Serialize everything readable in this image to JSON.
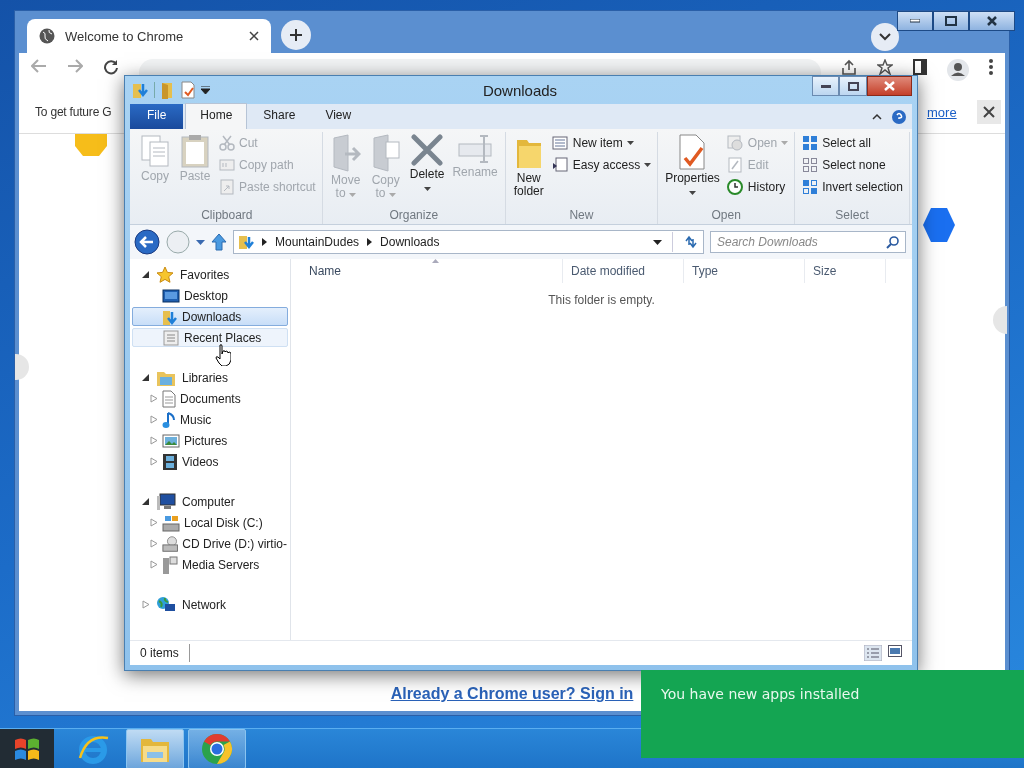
{
  "browser": {
    "tab": {
      "title": "Welcome to Chrome",
      "selected": true
    },
    "infobar": {
      "text": "To get future G",
      "link": "more"
    },
    "signin_link": "Already a Chrome user? Sign in"
  },
  "explorer": {
    "title": "Downloads",
    "ribbon_tabs": [
      {
        "label": "File",
        "kind": "file",
        "selected": false
      },
      {
        "label": "Home",
        "kind": "tab",
        "selected": true
      },
      {
        "label": "Share",
        "kind": "tab",
        "selected": false
      },
      {
        "label": "View",
        "kind": "tab",
        "selected": false
      }
    ],
    "ribbon_groups": [
      {
        "label": "Clipboard",
        "commands": [
          {
            "label": "Copy",
            "kind": "large",
            "disabled": true,
            "menu": false
          },
          {
            "label": "Paste",
            "kind": "large",
            "disabled": true,
            "menu": false
          },
          {
            "label": "Cut",
            "kind": "small",
            "disabled": true,
            "menu": false
          },
          {
            "label": "Copy path",
            "kind": "small",
            "disabled": true,
            "menu": false
          },
          {
            "label": "Paste shortcut",
            "kind": "small",
            "disabled": true,
            "menu": false
          }
        ]
      },
      {
        "label": "Organize",
        "commands": [
          {
            "label": "Move to",
            "kind": "large",
            "disabled": true,
            "menu": true
          },
          {
            "label": "Copy to",
            "kind": "large",
            "disabled": true,
            "menu": true
          },
          {
            "label": "Delete",
            "kind": "large",
            "disabled": false,
            "menu": true
          },
          {
            "label": "Rename",
            "kind": "large",
            "disabled": true,
            "menu": false
          }
        ]
      },
      {
        "label": "New",
        "commands": [
          {
            "label": "New folder",
            "kind": "large",
            "disabled": false,
            "menu": false
          },
          {
            "label": "New item",
            "kind": "small",
            "disabled": false,
            "menu": true
          },
          {
            "label": "Easy access",
            "kind": "small",
            "disabled": false,
            "menu": true
          }
        ]
      },
      {
        "label": "Open",
        "commands": [
          {
            "label": "Properties",
            "kind": "large",
            "disabled": false,
            "menu": true
          },
          {
            "label": "Open",
            "kind": "small",
            "disabled": true,
            "menu": true
          },
          {
            "label": "Edit",
            "kind": "small",
            "disabled": true,
            "menu": false
          },
          {
            "label": "History",
            "kind": "small",
            "disabled": false,
            "menu": false
          }
        ]
      },
      {
        "label": "Select",
        "commands": [
          {
            "label": "Select all",
            "kind": "small",
            "disabled": false,
            "menu": false
          },
          {
            "label": "Select none",
            "kind": "small",
            "disabled": false,
            "menu": false
          },
          {
            "label": "Invert selection",
            "kind": "small",
            "disabled": false,
            "menu": false
          }
        ]
      }
    ],
    "address": {
      "crumbs": [
        "MountainDudes",
        "Downloads"
      ]
    },
    "search": {
      "placeholder": "Search Downloads"
    },
    "nav": [
      {
        "label": "Favorites",
        "expanded": true,
        "children": [
          {
            "label": "Desktop",
            "selected": false,
            "hovered": false
          },
          {
            "label": "Downloads",
            "selected": true,
            "hovered": false
          },
          {
            "label": "Recent Places",
            "selected": false,
            "hovered": true
          }
        ]
      },
      {
        "label": "Libraries",
        "expanded": true,
        "children": [
          {
            "label": "Documents",
            "expanded": false
          },
          {
            "label": "Music",
            "expanded": false
          },
          {
            "label": "Pictures",
            "expanded": false
          },
          {
            "label": "Videos",
            "expanded": false
          }
        ]
      },
      {
        "label": "Computer",
        "expanded": true,
        "children": [
          {
            "label": "Local Disk (C:)",
            "expanded": false
          },
          {
            "label": "CD Drive (D:) virtio-",
            "expanded": false
          },
          {
            "label": "Media Servers",
            "expanded": false
          }
        ]
      },
      {
        "label": "Network",
        "expanded": false
      }
    ],
    "columns": [
      {
        "label": "Name",
        "sorted": true
      },
      {
        "label": "Date modified",
        "sorted": false
      },
      {
        "label": "Type",
        "sorted": false
      },
      {
        "label": "Size",
        "sorted": false
      }
    ],
    "empty_text": "This folder is empty.",
    "status": "0 items"
  },
  "toast": {
    "text": "You have new apps installed"
  },
  "taskbar": {
    "items": [
      {
        "kind": "start",
        "selected": false
      },
      {
        "kind": "ie",
        "selected": false
      },
      {
        "kind": "explorer",
        "selected": true
      },
      {
        "kind": "chrome",
        "selected": false
      }
    ]
  }
}
